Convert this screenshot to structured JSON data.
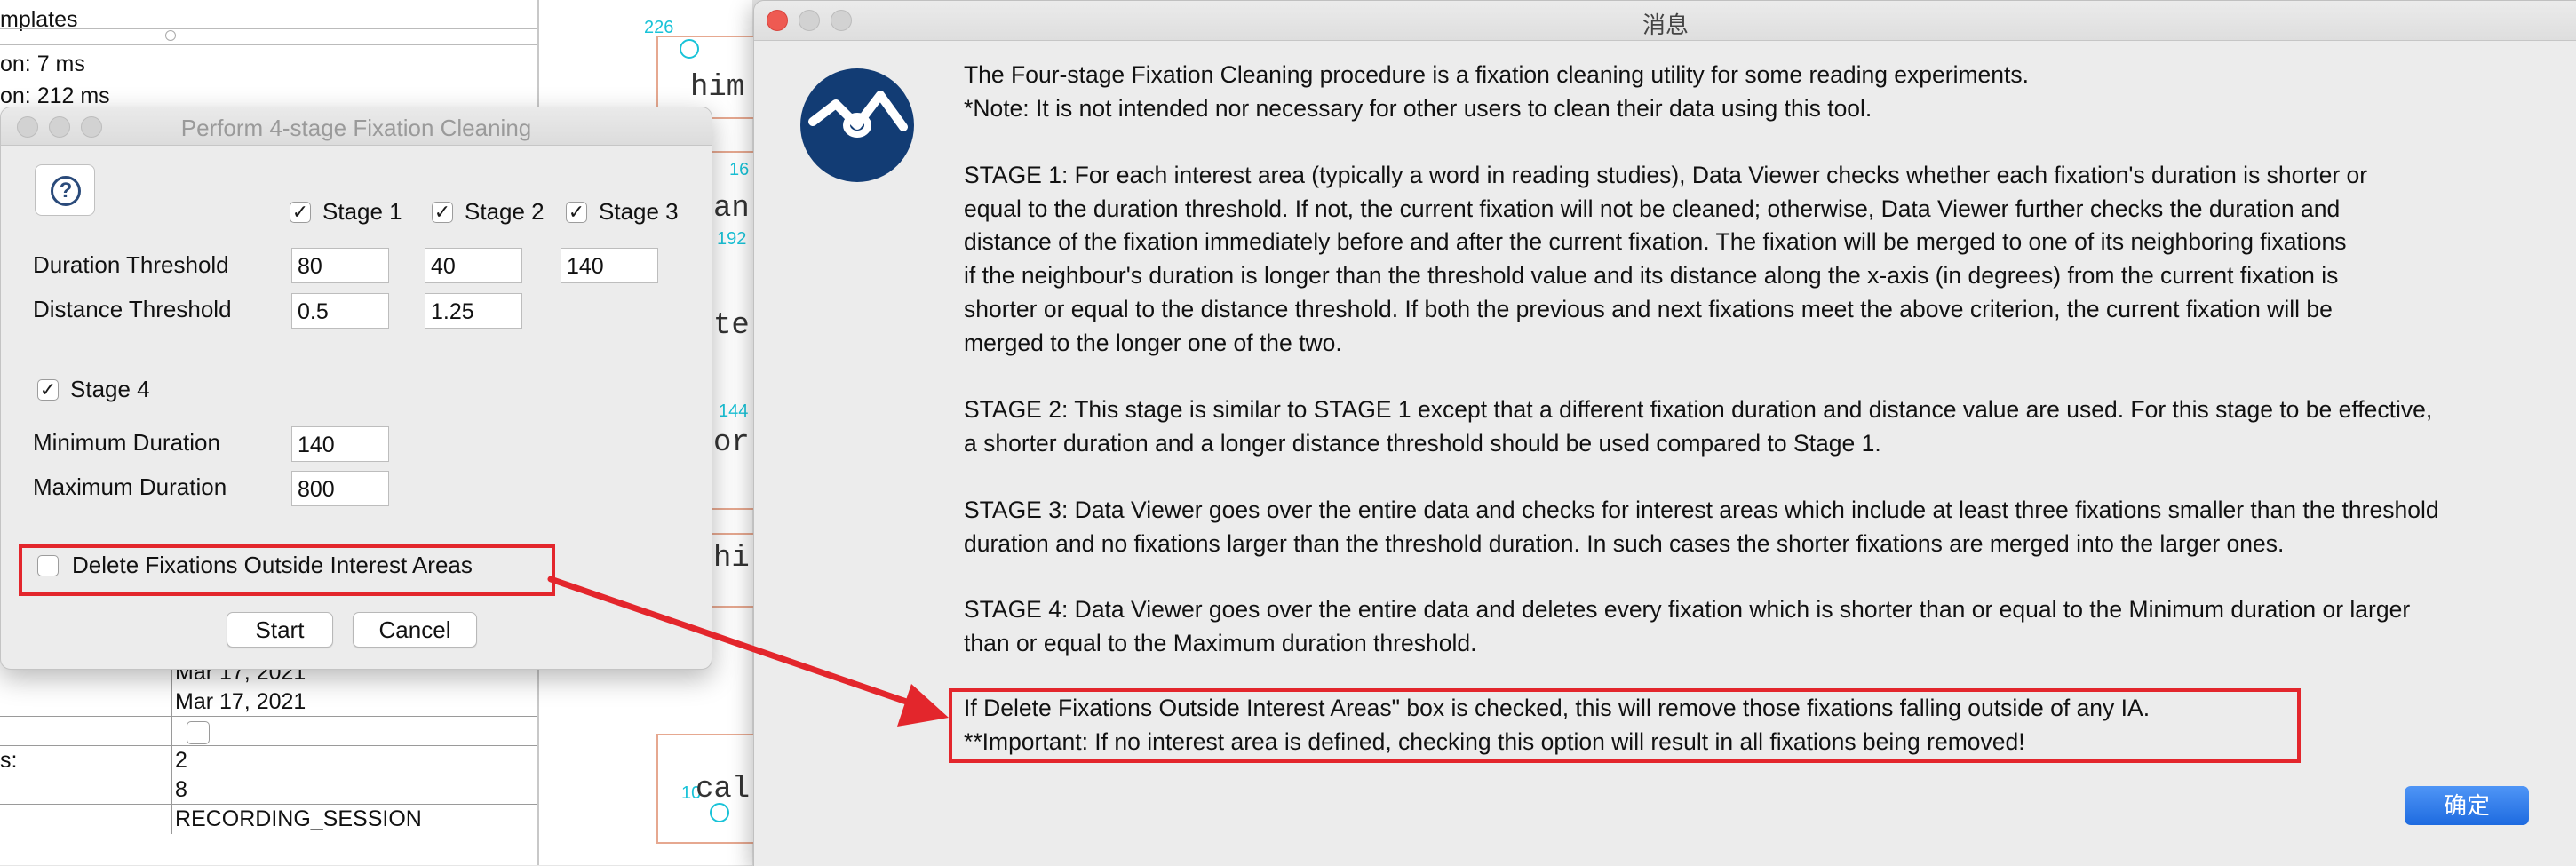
{
  "background_left": {
    "line1": "mplates",
    "line2": "on: 7 ms",
    "line3": "on: 212 ms",
    "rows": [
      {
        "label": "",
        "value": "Mar 17, 2021"
      },
      {
        "label": "",
        "value": "Mar 17, 2021"
      },
      {
        "label": "",
        "value": ""
      },
      {
        "label": "s:",
        "value": "2"
      },
      {
        "label": "",
        "value": "8"
      },
      {
        "label": "",
        "value": "RECORDING_SESSION"
      }
    ]
  },
  "background_canvas": {
    "words": [
      "him",
      "an",
      "te",
      "or",
      "hi",
      "cal"
    ],
    "fix_numbers": [
      "226",
      "16",
      "192",
      "144",
      "16",
      "10"
    ]
  },
  "cleaning_dialog": {
    "title": "Perform 4-stage Fixation Cleaning",
    "help_icon": "question-circle",
    "stage1": "Stage 1",
    "stage2": "Stage 2",
    "stage3": "Stage 3",
    "stage_checked": "✓",
    "duration_label": "Duration Threshold",
    "distance_label": "Distance Threshold",
    "duration_values": [
      "80",
      "40",
      "140"
    ],
    "distance_values": [
      "0.5",
      "1.25"
    ],
    "stage4": "Stage 4",
    "min_duration_label": "Minimum Duration",
    "max_duration_label": "Maximum Duration",
    "min_duration": "140",
    "max_duration": "800",
    "delete_outside_label": "Delete Fixations Outside Interest Areas",
    "start_label": "Start",
    "cancel_label": "Cancel"
  },
  "message_dialog": {
    "title": "消息",
    "logo_icon": "sr-research-logo",
    "para_intro": [
      "The Four-stage Fixation Cleaning procedure is a fixation cleaning utility for some reading experiments.",
      "*Note: It is not intended nor necessary for other users to clean their data using this tool."
    ],
    "para_stage1": [
      "STAGE 1: For each interest area (typically a word in reading studies), Data Viewer checks whether each fixation's duration is shorter or",
      "equal to the duration threshold. If not, the current fixation will not be cleaned; otherwise, Data Viewer further checks the duration and",
      "distance of the fixation immediately before and after the current fixation. The fixation will be merged to one of its neighboring fixations",
      "if the neighbour's duration is longer than the threshold value and its distance along the x-axis (in degrees) from the current fixation is",
      "shorter or equal to the distance threshold. If both the previous and next fixations meet the above criterion, the current fixation will be",
      "merged to the longer one of the two."
    ],
    "para_stage2": [
      "STAGE 2: This stage is similar to STAGE 1 except that a different fixation duration and distance value are used. For this stage to be effective,",
      "a shorter duration and a longer distance threshold should be used compared to Stage 1."
    ],
    "para_stage3": [
      "STAGE 3: Data Viewer goes over the entire data and checks for interest areas which include at least three fixations smaller than the threshold",
      "duration and no fixations larger than the threshold duration. In such cases the shorter fixations are merged into the larger ones."
    ],
    "para_stage4": [
      "STAGE 4: Data Viewer goes over the entire data and deletes every fixation which is shorter than or equal to the Minimum duration or larger",
      "than or equal to the Maximum duration threshold."
    ],
    "para_delete": [
      "If Delete Fixations Outside Interest Areas\" box is checked, this will remove those fixations falling outside of any IA.",
      "**Important: If no interest area is defined, checking this option will result in all fixations being removed!"
    ],
    "ok_label": "确定"
  },
  "colors": {
    "highlight_red": "#e3262c",
    "ok_blue": "#1e6be0",
    "logo_navy": "#123c74",
    "fixation_cyan": "#19c3d8"
  }
}
